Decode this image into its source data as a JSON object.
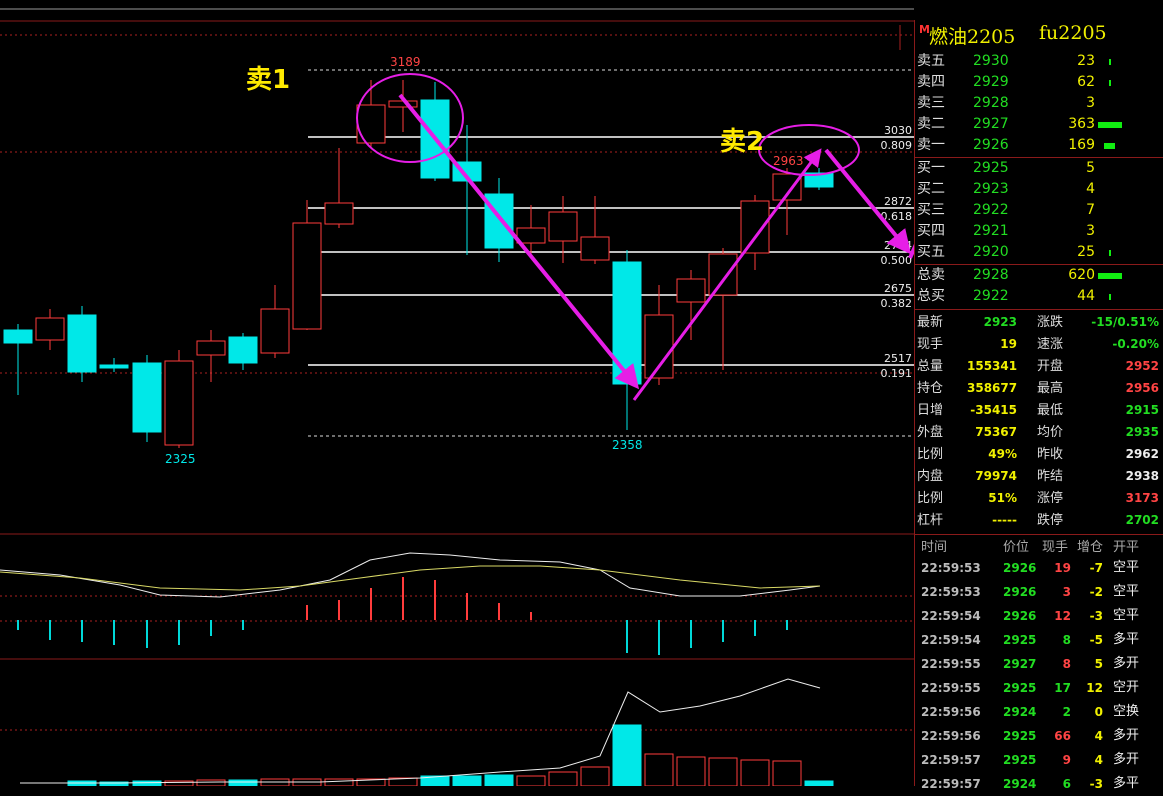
{
  "header": {
    "title": "燃油2205",
    "code": "fu2205",
    "badge": "M"
  },
  "orderbook": {
    "asks": [
      {
        "label": "卖五",
        "price": "2930",
        "vol": "23",
        "bar": 0.05
      },
      {
        "label": "卖四",
        "price": "2929",
        "vol": "62",
        "bar": 0.1
      },
      {
        "label": "卖三",
        "price": "2928",
        "vol": "3",
        "bar": 0
      },
      {
        "label": "卖二",
        "price": "2927",
        "vol": "363",
        "bar": 1
      },
      {
        "label": "卖一",
        "price": "2926",
        "vol": "169",
        "bar": 0.45
      }
    ],
    "bids": [
      {
        "label": "买一",
        "price": "2925",
        "vol": "5",
        "bar": 0
      },
      {
        "label": "买二",
        "price": "2923",
        "vol": "4",
        "bar": 0
      },
      {
        "label": "买三",
        "price": "2922",
        "vol": "7",
        "bar": 0
      },
      {
        "label": "买四",
        "price": "2921",
        "vol": "3",
        "bar": 0
      },
      {
        "label": "买五",
        "price": "2920",
        "vol": "25",
        "bar": 0.05
      }
    ],
    "totals": [
      {
        "label": "总卖",
        "price": "2928",
        "vol": "620",
        "bar": 1
      },
      {
        "label": "总买",
        "price": "2922",
        "vol": "44",
        "bar": 0.07
      }
    ]
  },
  "stats": [
    {
      "l1": "最新",
      "v1": "2923",
      "c1": "grn",
      "l2": "涨跌",
      "v2": "-15/0.51%",
      "c2": "grn"
    },
    {
      "l1": "现手",
      "v1": "19",
      "c1": "yel",
      "l2": "速涨",
      "v2": "-0.20%",
      "c2": "grn"
    },
    {
      "l1": "总量",
      "v1": "155341",
      "c1": "yel",
      "l2": "开盘",
      "v2": "2952",
      "c2": "red"
    },
    {
      "l1": "持仓",
      "v1": "358677",
      "c1": "yel",
      "l2": "最高",
      "v2": "2956",
      "c2": "red"
    },
    {
      "l1": "日增",
      "v1": "-35415",
      "c1": "yel",
      "l2": "最低",
      "v2": "2915",
      "c2": "grn"
    },
    {
      "l1": "外盘",
      "v1": "75367",
      "c1": "yel",
      "l2": "均价",
      "v2": "2935",
      "c2": "grn"
    },
    {
      "l1": "比例",
      "v1": "49%",
      "c1": "yel",
      "l2": "昨收",
      "v2": "2962",
      "c2": "wht"
    },
    {
      "l1": "内盘",
      "v1": "79974",
      "c1": "yel",
      "l2": "昨结",
      "v2": "2938",
      "c2": "wht"
    },
    {
      "l1": "比例",
      "v1": "51%",
      "c1": "yel",
      "l2": "涨停",
      "v2": "3173",
      "c2": "red"
    },
    {
      "l1": "杠杆",
      "v1": "-----",
      "c1": "yel",
      "l2": "跌停",
      "v2": "2702",
      "c2": "grn"
    }
  ],
  "trades_header": {
    "time": "时间",
    "price": "价位",
    "vol": "现手",
    "inc": "增仓",
    "kind": "开平"
  },
  "trades": [
    {
      "time": "22:59:53",
      "price": "2926",
      "vol": "19",
      "vc": "red",
      "inc": "-7",
      "kind": "空平",
      "kc": "wht"
    },
    {
      "time": "22:59:53",
      "price": "2926",
      "vol": "3",
      "vc": "red",
      "inc": "-2",
      "kind": "空平",
      "kc": "wht"
    },
    {
      "time": "22:59:54",
      "price": "2926",
      "vol": "12",
      "vc": "red",
      "inc": "-3",
      "kind": "空平",
      "kc": "wht"
    },
    {
      "time": "22:59:54",
      "price": "2925",
      "vol": "8",
      "vc": "grn",
      "inc": "-5",
      "kind": "多平",
      "kc": "wht"
    },
    {
      "time": "22:59:55",
      "price": "2927",
      "vol": "8",
      "vc": "red",
      "inc": "5",
      "kind": "多开",
      "kc": "wht"
    },
    {
      "time": "22:59:55",
      "price": "2925",
      "vol": "17",
      "vc": "grn",
      "inc": "12",
      "kind": "空开",
      "kc": "wht"
    },
    {
      "time": "22:59:56",
      "price": "2924",
      "vol": "2",
      "vc": "grn",
      "inc": "0",
      "kind": "空换",
      "kc": "wht"
    },
    {
      "time": "22:59:56",
      "price": "2925",
      "vol": "66",
      "vc": "red",
      "inc": "4",
      "kind": "多开",
      "kc": "wht"
    },
    {
      "time": "22:59:57",
      "price": "2925",
      "vol": "9",
      "vc": "red",
      "inc": "4",
      "kind": "多开",
      "kc": "wht"
    },
    {
      "time": "22:59:57",
      "price": "2924",
      "vol": "6",
      "vc": "grn",
      "inc": "-3",
      "kind": "多平",
      "kc": "wht"
    }
  ],
  "chart": {
    "annotations": {
      "sell1": "卖1",
      "sell2": "卖2"
    },
    "price_labels": {
      "high": "3189",
      "low": "2358",
      "left_low": "2325",
      "sell2_peak": "2963"
    },
    "fib_levels": [
      {
        "price": "3030",
        "ratio": "0.809"
      },
      {
        "price": "2872",
        "ratio": "0.618"
      },
      {
        "price": "2774",
        "ratio": "0.500"
      },
      {
        "price": "2675",
        "ratio": "0.382"
      },
      {
        "price": "2517",
        "ratio": "0.191"
      }
    ],
    "colors": {
      "up": "#ff3c3c",
      "down": "#00e8e8",
      "annotation": "#ffea00",
      "arrow": "#e61ee6",
      "fib": "#ffffff"
    }
  }
}
